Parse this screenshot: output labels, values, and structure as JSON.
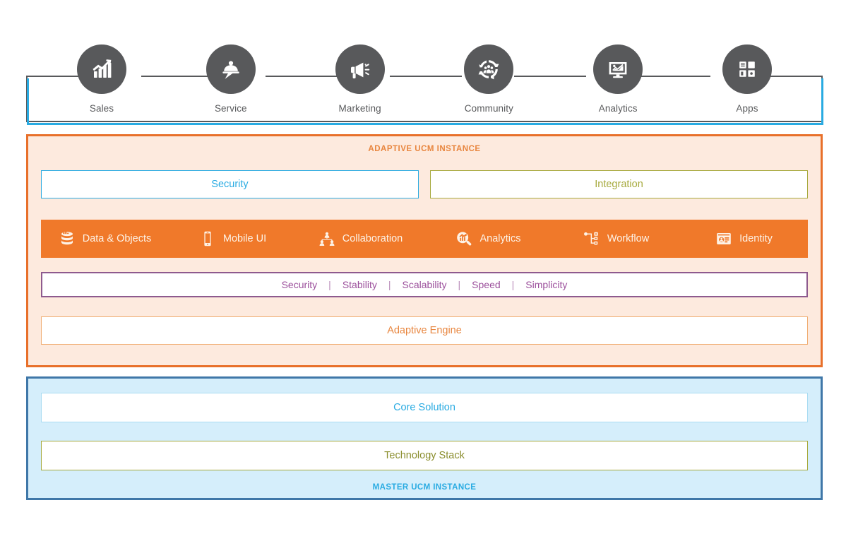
{
  "channels": {
    "items": [
      {
        "label": "Sales",
        "icon": "bar-chart-growth-icon"
      },
      {
        "label": "Service",
        "icon": "service-bell-icon"
      },
      {
        "label": "Marketing",
        "icon": "megaphone-icon"
      },
      {
        "label": "Community",
        "icon": "community-people-icon"
      },
      {
        "label": "Analytics",
        "icon": "monitor-chart-icon"
      },
      {
        "label": "Apps",
        "icon": "app-grid-icon"
      }
    ],
    "rail_color": "#58595b",
    "accent_color": "#29abe2",
    "circle_color": "#58595b"
  },
  "adaptive": {
    "title": "ADAPTIVE UCM INSTANCE",
    "border_color": "#e8702a",
    "background_color": "#fdeade",
    "title_color": "#e8863f",
    "top_pills": [
      {
        "label": "Security",
        "color": "#29abe2"
      },
      {
        "label": "Integration",
        "color": "#a6a93c"
      }
    ],
    "capability_bar": {
      "background_color": "#f0792a",
      "text_color": "#fdf2e6",
      "items": [
        {
          "label": "Data & Objects",
          "icon": "database-icon"
        },
        {
          "label": "Mobile UI",
          "icon": "mobile-phone-icon"
        },
        {
          "label": "Collaboration",
          "icon": "collaboration-network-icon"
        },
        {
          "label": "Analytics",
          "icon": "magnifier-chart-icon"
        },
        {
          "label": "Workflow",
          "icon": "workflow-nodes-icon"
        },
        {
          "label": "Identity",
          "icon": "identity-card-icon"
        }
      ]
    },
    "qualities": {
      "border_color": "#8e5a8e",
      "text_color": "#9b4f9b",
      "separator": "|",
      "items": [
        "Security",
        "Stability",
        "Scalability",
        "Speed",
        "Simplicity"
      ]
    },
    "engine": {
      "label": "Adaptive Engine",
      "color": "#e8863f",
      "border_color": "#f0ad72"
    }
  },
  "master": {
    "title": "MASTER UCM INSTANCE",
    "border_color": "#3f77a8",
    "background_color": "#d5eefb",
    "title_color": "#29abe2",
    "rows": [
      {
        "label": "Core Solution",
        "color": "#29abe2",
        "border_color": "#a9dcf2"
      },
      {
        "label": "Technology Stack",
        "color": "#8b8e2e",
        "border_color": "#a6a93c"
      }
    ]
  }
}
